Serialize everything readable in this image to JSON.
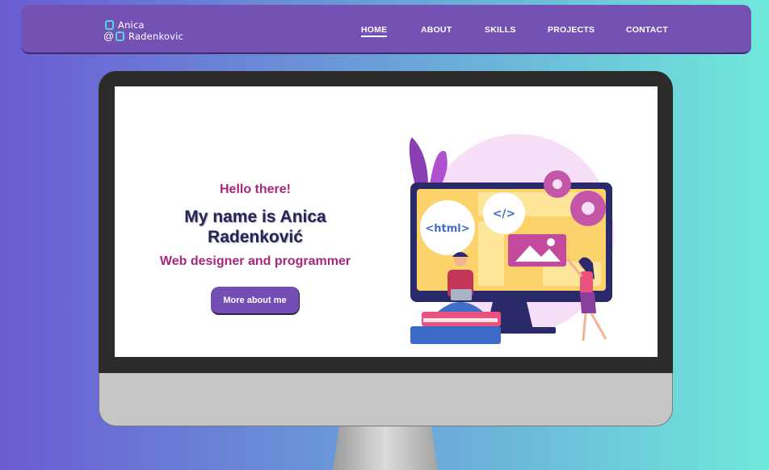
{
  "logo": {
    "line1": "Anica",
    "line2": "Radenkovic",
    "at_symbol": "@"
  },
  "nav": {
    "items": [
      {
        "label": "HOME",
        "active": true
      },
      {
        "label": "ABOUT",
        "active": false
      },
      {
        "label": "SKILLS",
        "active": false
      },
      {
        "label": "PROJECTS",
        "active": false
      },
      {
        "label": "CONTACT",
        "active": false
      }
    ]
  },
  "hero": {
    "greeting": "Hello there!",
    "name_line1": "My name is Anica",
    "name_line2": "Radenković",
    "role": "Web designer and programmer",
    "cta_label": "More about me"
  },
  "illustration": {
    "html_tag": "<html>",
    "code_tag": "</>"
  },
  "colors": {
    "accent": "#744db5",
    "nav": "#7352b4",
    "highlight": "#a8267c",
    "logo_cyan": "#52d7de"
  }
}
